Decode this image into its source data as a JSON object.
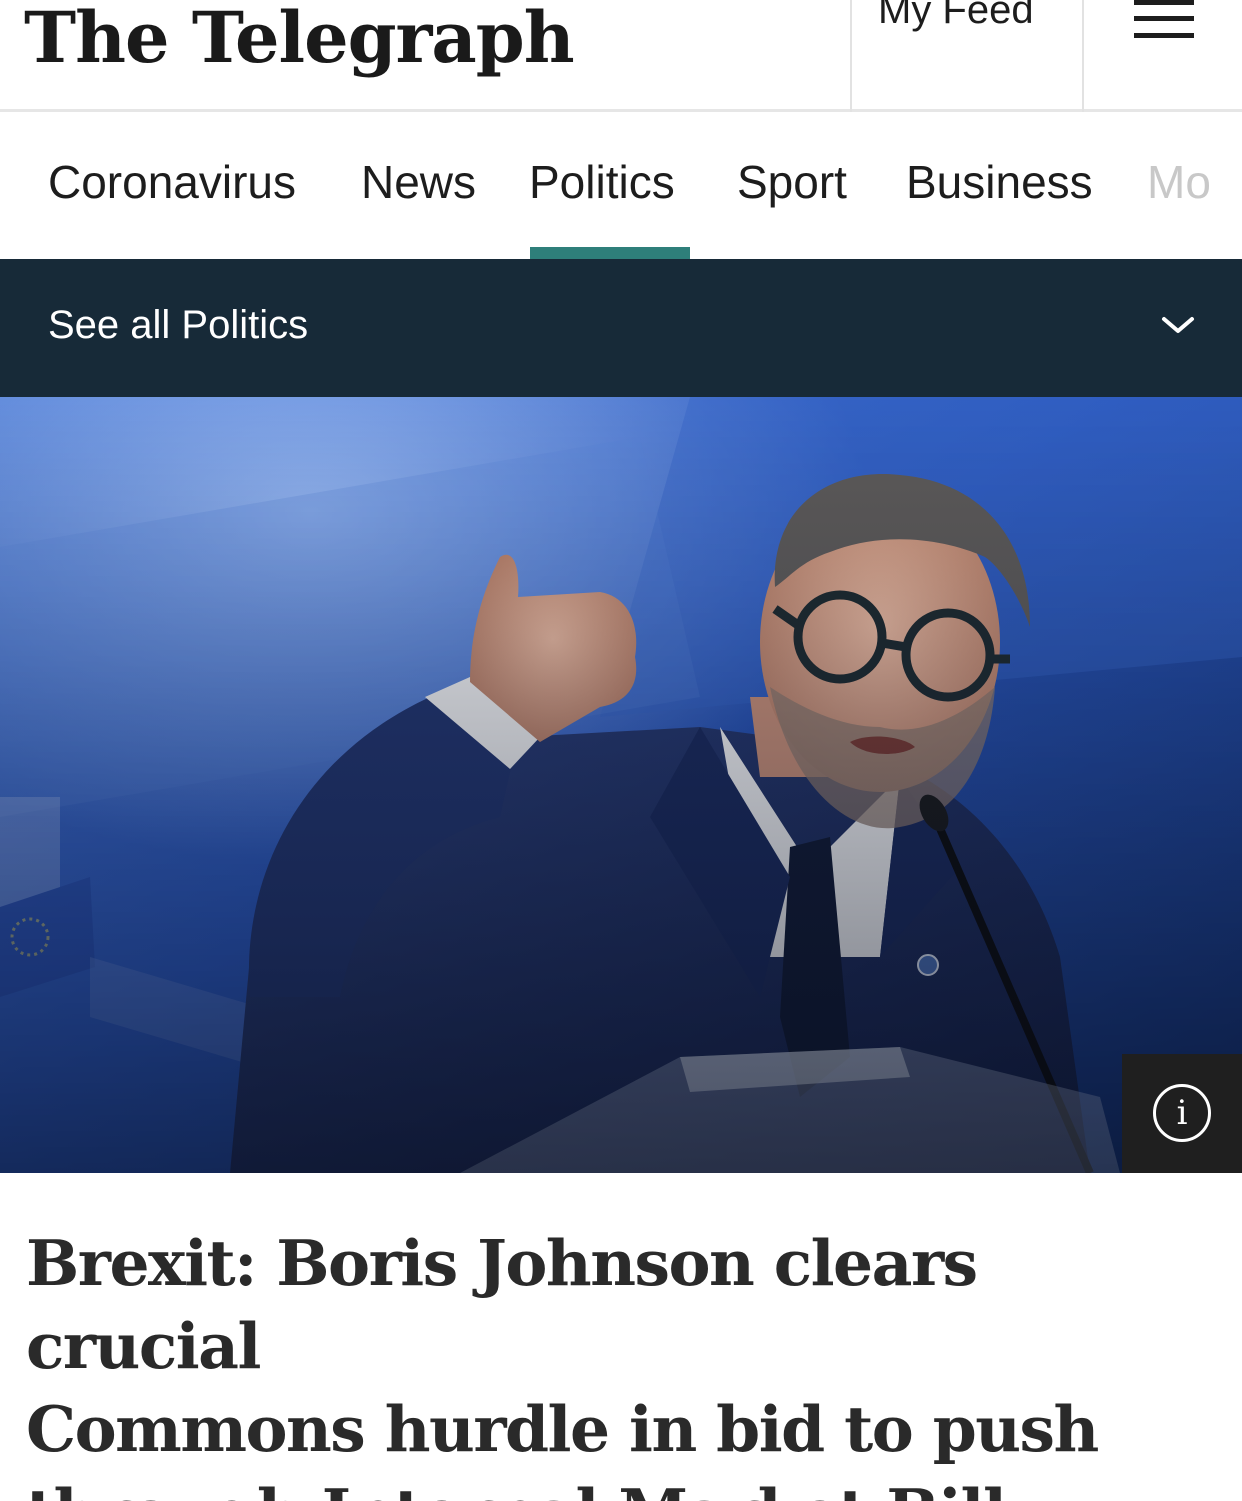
{
  "header": {
    "masthead": "The Telegraph",
    "my_feed_label": "My Feed",
    "menu_icon": "hamburger-menu-icon"
  },
  "nav": {
    "items": [
      {
        "label": "Coronavirus"
      },
      {
        "label": "News"
      },
      {
        "label": "Politics",
        "active": true
      },
      {
        "label": "Sport"
      },
      {
        "label": "Business"
      },
      {
        "label": "Mo"
      }
    ],
    "accent_color": "#2e7f7a"
  },
  "subnav": {
    "label": "See all Politics",
    "icon": "chevron-down-icon",
    "background": "#172a38"
  },
  "hero": {
    "info_icon": "info-icon",
    "info_label": "i"
  },
  "article": {
    "headline_lines": [
      "Brexit: Boris Johnson clears crucial",
      "Commons hurdle in bid to push",
      "through Internal Market Bill"
    ]
  }
}
